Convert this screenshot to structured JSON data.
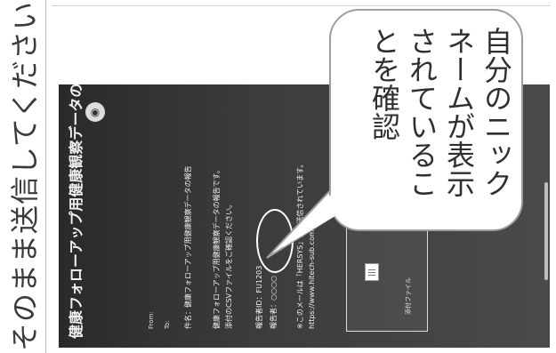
{
  "caption": "そのまま送信してください",
  "email": {
    "subject": "健康フォローアップ用健康観察データの報告",
    "from_label": "From:",
    "to_label": "To:",
    "body_line1": "件名：健康フォローアップ用健康観察データの報告",
    "body_line2": "健康フォローアップ用健康観察データの報告です。",
    "body_line3": "添付のCSVファイルをご確認ください。",
    "id_line": "報告者ID：FU1203",
    "nickname_line": "報告者：○○○○",
    "footer_line1": "※このメールは「HERSYS」から送信されています。",
    "footer_line2": "https://www.hitech-sub.com",
    "attachment_label": "添付ファイル"
  },
  "callout": {
    "columns": [
      "自分のニック",
      "ネームが表示",
      "されているこ",
      "とを確認"
    ]
  }
}
